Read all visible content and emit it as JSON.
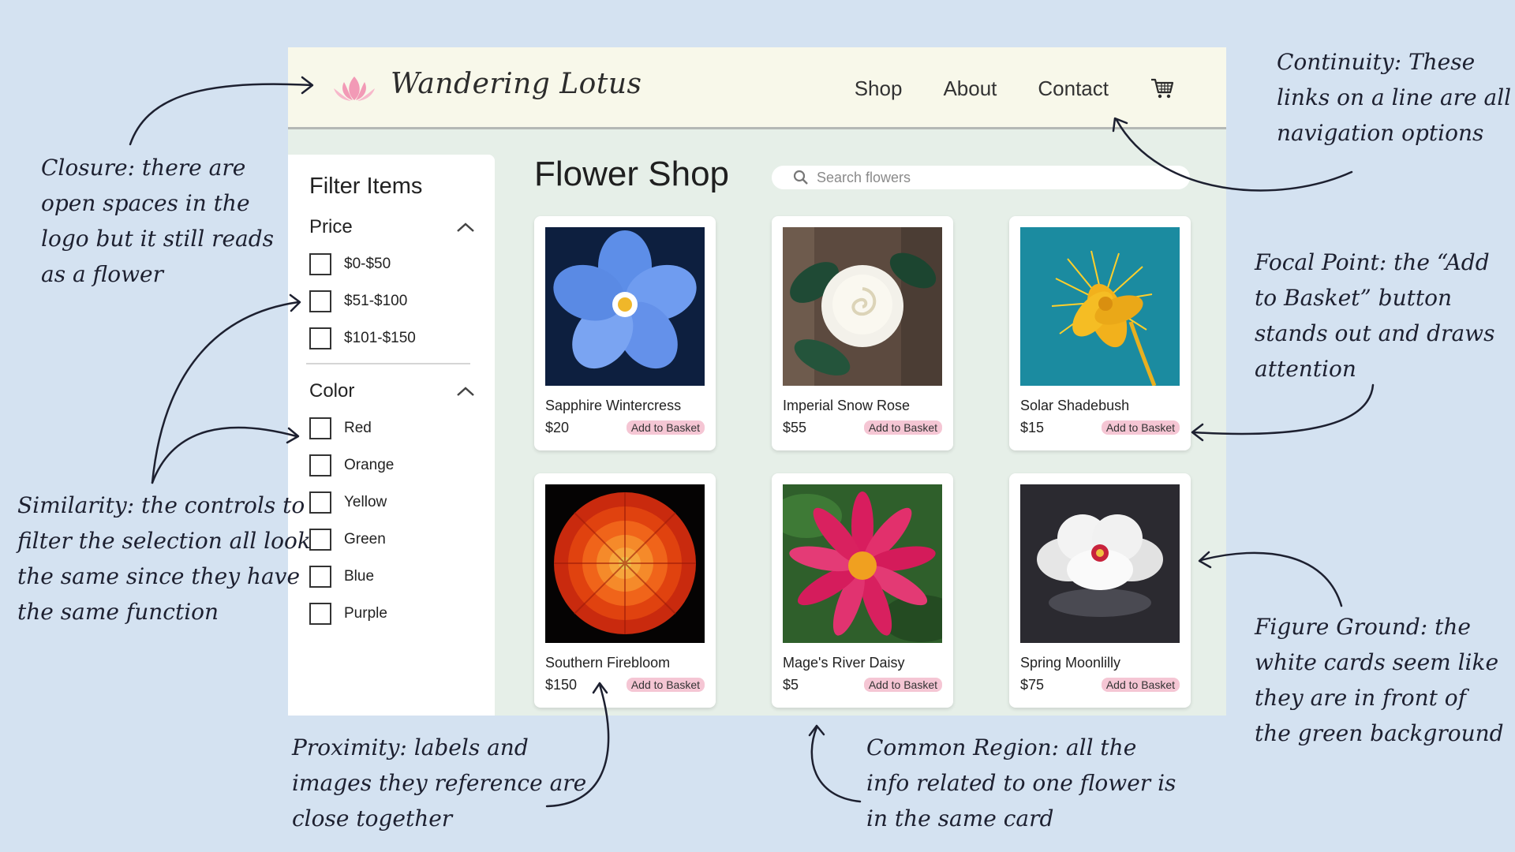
{
  "header": {
    "brand": "Wandering Lotus",
    "nav": [
      "Shop",
      "About",
      "Contact"
    ],
    "cart_icon": "cart-icon",
    "logo_icon": "lotus-logo-icon"
  },
  "filters": {
    "title": "Filter Items",
    "price": {
      "label": "Price",
      "options": [
        "$0-$50",
        "$51-$100",
        "$101-$150"
      ]
    },
    "color": {
      "label": "Color",
      "options": [
        "Red",
        "Orange",
        "Yellow",
        "Green",
        "Blue",
        "Purple"
      ]
    }
  },
  "main": {
    "title": "Flower Shop",
    "search_placeholder": "Search flowers",
    "products": [
      {
        "name": "Sapphire Wintercress",
        "price": "$20",
        "button": "Add to Basket"
      },
      {
        "name": "Imperial Snow Rose",
        "price": "$55",
        "button": "Add to Basket"
      },
      {
        "name": "Solar Shadebush",
        "price": "$15",
        "button": "Add to Basket"
      },
      {
        "name": "Southern Firebloom",
        "price": "$150",
        "button": "Add to Basket"
      },
      {
        "name": "Mage's River Daisy",
        "price": "$5",
        "button": "Add to Basket"
      },
      {
        "name": "Spring Moonlilly",
        "price": "$75",
        "button": "Add to Basket"
      }
    ]
  },
  "annotations": {
    "continuity": [
      "Continuity: These",
      "links on a line are all",
      "navigation options"
    ],
    "closure": [
      "Closure: there are",
      "open spaces in the",
      "logo but it still reads",
      "as a flower"
    ],
    "focal": [
      "Focal Point: the “Add",
      "to Basket” button",
      "stands out and draws",
      "attention"
    ],
    "similarity": [
      "Similarity: the controls to",
      "filter the selection all look",
      "the same since they have",
      "the same function"
    ],
    "figure": [
      "Figure Ground: the",
      "white cards seem like",
      "they are in front of",
      "the green background"
    ],
    "proximity": [
      "Proximity: labels and",
      "images they reference are",
      "close together"
    ],
    "common": [
      "Common Region: all the",
      "info related to one flower is",
      "in the same card"
    ]
  },
  "colors": {
    "page_bg": "#d4e2f1",
    "header_bg": "#f8f8ea",
    "app_bg": "#e6efe8",
    "button_pink": "#f5c6d4",
    "logo_pink": "#f29ab6"
  }
}
